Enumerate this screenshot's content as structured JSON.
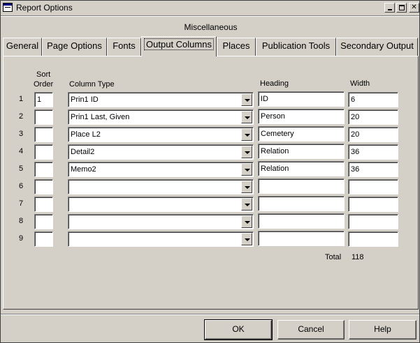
{
  "window": {
    "title": "Report Options"
  },
  "section_label": "Miscellaneous",
  "tabs": [
    {
      "label": "General"
    },
    {
      "label": "Page Options"
    },
    {
      "label": "Fonts"
    },
    {
      "label": "Output Columns"
    },
    {
      "label": "Places"
    },
    {
      "label": "Publication Tools"
    },
    {
      "label": "Secondary Output"
    }
  ],
  "active_tab": "Output Columns",
  "headers": {
    "sort_order_1": "Sort",
    "sort_order_2": "Order",
    "column_type": "Column Type",
    "heading": "Heading",
    "width": "Width"
  },
  "rows": [
    {
      "num": "1",
      "sort": "1",
      "column_type": "Prin1 ID",
      "heading": "ID",
      "width": "6"
    },
    {
      "num": "2",
      "sort": "",
      "column_type": "Prin1 Last, Given",
      "heading": "Person",
      "width": "20"
    },
    {
      "num": "3",
      "sort": "",
      "column_type": "Place L2",
      "heading": "Cemetery",
      "width": "20"
    },
    {
      "num": "4",
      "sort": "",
      "column_type": "Detail2",
      "heading": "Relation",
      "width": "36"
    },
    {
      "num": "5",
      "sort": "",
      "column_type": "Memo2",
      "heading": "Relation",
      "width": "36"
    },
    {
      "num": "6",
      "sort": "",
      "column_type": "",
      "heading": "",
      "width": ""
    },
    {
      "num": "7",
      "sort": "",
      "column_type": "",
      "heading": "",
      "width": ""
    },
    {
      "num": "8",
      "sort": "",
      "column_type": "",
      "heading": "",
      "width": ""
    },
    {
      "num": "9",
      "sort": "",
      "column_type": "",
      "heading": "",
      "width": ""
    }
  ],
  "total": {
    "label": "Total",
    "value": "118"
  },
  "buttons": {
    "ok": "OK",
    "cancel": "Cancel",
    "help": "Help"
  },
  "icons": {
    "app": "report-icon",
    "minimize": "minimize-icon",
    "maximize": "maximize-icon",
    "close": "close-icon",
    "dropdown": "chevron-down-icon"
  },
  "colors": {
    "face": "#d4d0c8",
    "field": "#ffffff"
  }
}
